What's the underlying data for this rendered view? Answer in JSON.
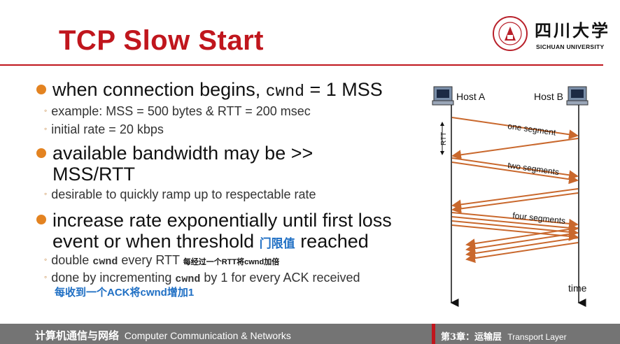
{
  "title": "TCP Slow Start",
  "university": {
    "name_cn": "四川大学",
    "name_en": "SICHUAN UNIVERSITY"
  },
  "bullets": [
    {
      "pre": "when connection begins, ",
      "code": "cwnd",
      "post": " = 1 MSS"
    },
    {
      "line1": "available bandwidth may be >>",
      "line2": "MSS/RTT"
    },
    {
      "line1": "increase rate exponentially until first loss",
      "line2_pre": "event or when threshold ",
      "line2_cn": "门限值",
      "line2_post": " reached"
    }
  ],
  "subs": {
    "b1": [
      "example: MSS = 500 bytes & RTT = 200 msec",
      "initial rate = 20 kbps"
    ],
    "b2": [
      "desirable to quickly ramp up to respectable rate"
    ],
    "b3_1": {
      "pre": "double ",
      "code": "cwnd",
      "post": " every RTT ",
      "note": "每经过一个RTT将cwnd加倍"
    },
    "b3_2": {
      "pre": "done by incrementing ",
      "code": "cwnd",
      "post": " by 1 for every ACK received",
      "note": "每收到一个ACK将cwnd增加1"
    }
  },
  "diagram": {
    "host_a": "Host A",
    "host_b": "Host B",
    "rtt": "RTT",
    "one_segment": "one segment",
    "two_segments": "two segments",
    "four_segments": "four segments",
    "time": "time",
    "arrow_color": "#c9682d"
  },
  "footer": {
    "left_cn": "计算机通信与网络",
    "left_en": "Computer Communication & Networks",
    "right_cn": "第3章：运输层",
    "right_en": "Transport Layer"
  },
  "colors": {
    "accent": "#c0161d",
    "bullet": "#e38321",
    "blue": "#1f6fc4",
    "footer": "#747474"
  }
}
